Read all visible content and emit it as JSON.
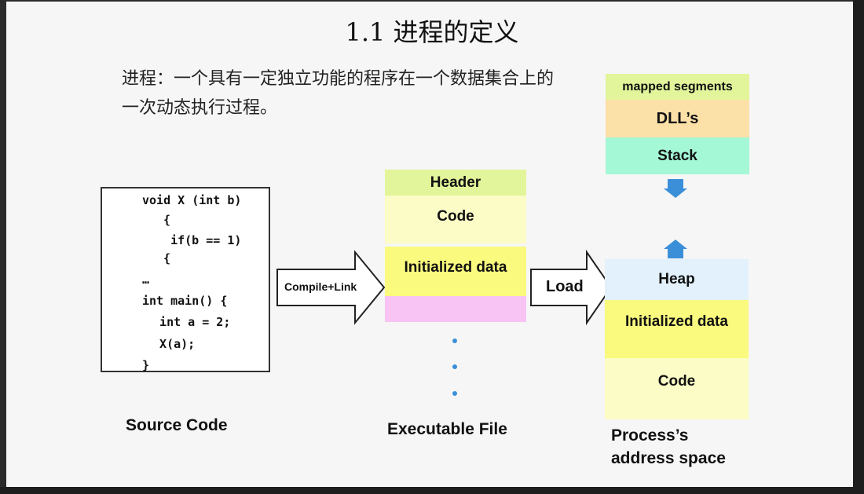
{
  "title": "1.1  进程的定义",
  "definition": "进程：一个具有一定独立功能的程序在一个数据集合上的一次动态执行过程。",
  "source_code": {
    "lines": [
      "void X (int b)",
      "  {",
      "   if(b == 1)",
      "  {",
      "…",
      "int main() {",
      "  int a = 2;",
      "  X(a);",
      "}"
    ],
    "caption": "Source Code"
  },
  "compile_arrow_label": "Compile+Link",
  "executable": {
    "segments": [
      "Header",
      "Code",
      "Initialized data",
      ""
    ],
    "caption": "Executable File"
  },
  "load_arrow_label": "Load",
  "process": {
    "upper_segments": [
      "mapped segments",
      "DLL’s",
      "Stack"
    ],
    "lower_segments": [
      "Heap",
      "Initialized data",
      "Code"
    ],
    "caption_line1": "Process’s",
    "caption_line2": "address space"
  },
  "colors": {
    "header": "#e2f59a",
    "code": "#fcfcc6",
    "initialized_data": "#fafa7e",
    "empty_segment": "#f8c4f4",
    "mapped_segments": "#e2f59a",
    "dlls": "#fbe0a8",
    "stack": "#a4f8d6",
    "heap": "#e2f1fb",
    "accent_blue": "#3b8fd9"
  }
}
